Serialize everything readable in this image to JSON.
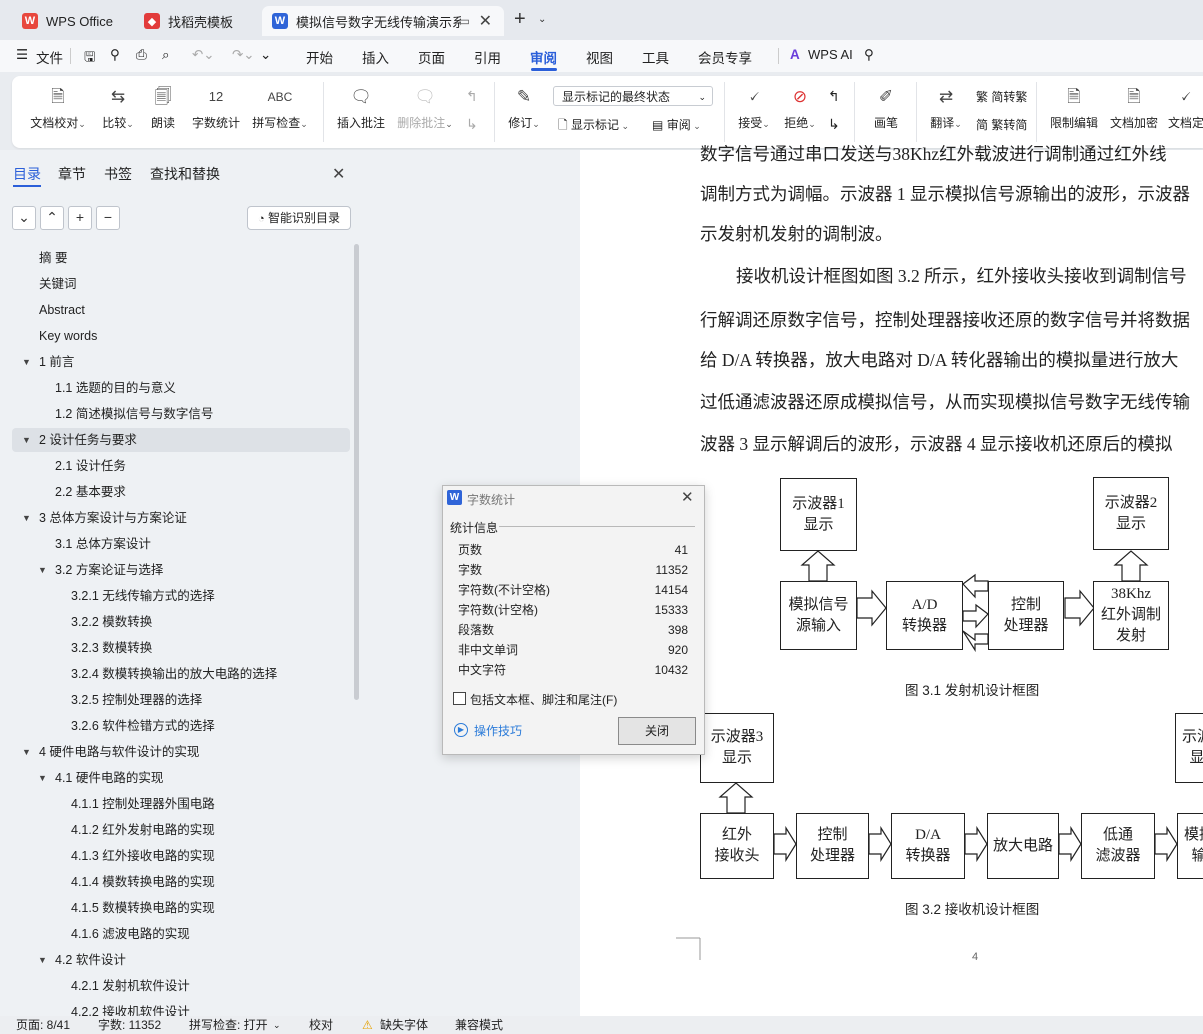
{
  "tabs": [
    {
      "label": "WPS Office"
    },
    {
      "label": "找稻壳模板"
    },
    {
      "label": "模拟信号数字无线传输演示系"
    }
  ],
  "menu": [
    "文件",
    "开始",
    "插入",
    "页面",
    "引用",
    "审阅",
    "视图",
    "工具",
    "会员专享",
    "WPS AI"
  ],
  "ribbon": {
    "doc_check": "文档校对",
    "compare": "比较",
    "read": "朗读",
    "word_count": "字数统计",
    "spell": "拼写检查",
    "insert_comment": "插入批注",
    "delete_comment": "删除批注",
    "revise": "修订",
    "show_mode": "显示标记的最终状态",
    "show_marks": "显示标记",
    "review": "审阅",
    "accept": "接受",
    "reject": "拒绝",
    "pen": "画笔",
    "translate": "翻译",
    "to_trad": "简转繁",
    "to_simp": "繁转简",
    "restrict": "限制编辑",
    "encrypt": "文档加密",
    "doc_final": "文档定"
  },
  "panel": {
    "tabs": [
      "目录",
      "章节",
      "书签",
      "查找和替换"
    ],
    "smart_btn": "智能识别目录",
    "toc": [
      {
        "label": "摘  要",
        "level": 0
      },
      {
        "label": "关键词",
        "level": 0
      },
      {
        "label": "Abstract",
        "level": 0
      },
      {
        "label": "Key words",
        "level": 0
      },
      {
        "label": "1  前言",
        "level": 0,
        "arrow": true
      },
      {
        "label": "1.1  选题的目的与意义",
        "level": 1
      },
      {
        "label": "1.2 简述模拟信号与数字信号",
        "level": 1
      },
      {
        "label": "2  设计任务与要求",
        "level": 0,
        "arrow": true,
        "selected": true
      },
      {
        "label": "2.1  设计任务",
        "level": 1
      },
      {
        "label": "2.2    基本要求",
        "level": 1
      },
      {
        "label": "3  总体方案设计与方案论证",
        "level": 0,
        "arrow": true
      },
      {
        "label": "3.1 总体方案设计",
        "level": 1
      },
      {
        "label": "3.2  方案论证与选择",
        "level": 1,
        "arrow": true
      },
      {
        "label": "3.2.1  无线传输方式的选择",
        "level": 2
      },
      {
        "label": "3.2.2  模数转换",
        "level": 2
      },
      {
        "label": "3.2.3  数模转换",
        "level": 2
      },
      {
        "label": "3.2.4  数模转换输出的放大电路的选择",
        "level": 2
      },
      {
        "label": "3.2.5  控制处理器的选择",
        "level": 2
      },
      {
        "label": "3.2.6  软件检错方式的选择",
        "level": 2
      },
      {
        "label": "4  硬件电路与软件设计的实现",
        "level": 0,
        "arrow": true
      },
      {
        "label": "4.1  硬件电路的实现",
        "level": 1,
        "arrow": true
      },
      {
        "label": "4.1.1  控制处理器外围电路",
        "level": 2
      },
      {
        "label": "4.1.2  红外发射电路的实现",
        "level": 2
      },
      {
        "label": "4.1.3  红外接收电路的实现",
        "level": 2
      },
      {
        "label": "4.1.4  模数转换电路的实现",
        "level": 2
      },
      {
        "label": "4.1.5 数模转换电路的实现",
        "level": 2
      },
      {
        "label": "4.1.6 滤波电路的实现",
        "level": 2
      },
      {
        "label": "4.2  软件设计",
        "level": 1,
        "arrow": true
      },
      {
        "label": "4.2.1  发射机软件设计",
        "level": 2
      },
      {
        "label": "4.2.2  接收机软件设计",
        "level": 2
      }
    ]
  },
  "doc": {
    "lines": [
      "数字信号通过串口发送与38Khz红外载波进行调制通过红外线",
      "调制方式为调幅。示波器 1 显示模拟信号源输出的波形，示波器",
      "示发射机发射的调制波。",
      "接收机设计框图如图 3.2 所示，红外接收头接收到调制信号",
      "行解调还原数字信号，控制处理器接收还原的数字信号并将数据",
      "给 D/A 转换器，放大电路对 D/A 转化器输出的模拟量进行放大",
      "过低通滤波器还原成模拟信号，从而实现模拟信号数字无线传输",
      "波器 3 显示解调后的波形，示波器 4 显示接收机还原后的模拟"
    ],
    "fig1": {
      "osc1": "示波器1\n显示",
      "osc2": "示波器2\n显示",
      "src": "模拟信号\n源输入",
      "ad": "A/D\n转换器",
      "ctrl": "控制\n处理器",
      "ir": "38Khz\n红外调制\n发射",
      "caption": "图 3.1  发射机设计框图"
    },
    "fig2": {
      "osc3": "示波器3\n显示",
      "osc4": "示波\n显",
      "irrx": "红外\n接收头",
      "ctrl": "控制\n处理器",
      "da": "D/A\n转换器",
      "amp": "放大电路",
      "lpf": "低通\n滤波器",
      "out": "模拟\n输",
      "caption": "图 3.2  接收机设计框图"
    },
    "page_num": "4"
  },
  "dialog": {
    "title": "字数统计",
    "section": "统计信息",
    "rows": [
      {
        "k": "页数",
        "v": "41"
      },
      {
        "k": "字数",
        "v": "11352"
      },
      {
        "k": "字符数(不计空格)",
        "v": "14154"
      },
      {
        "k": "字符数(计空格)",
        "v": "15333"
      },
      {
        "k": "段落数",
        "v": "398"
      },
      {
        "k": "非中文单词",
        "v": "920"
      },
      {
        "k": "中文字符",
        "v": "10432"
      }
    ],
    "checkbox": "包括文本框、脚注和尾注(F)",
    "tips": "操作技巧",
    "close": "关闭"
  },
  "status": {
    "page": "页面: 8/41",
    "words": "字数: 11352",
    "spell": "拼写检查: 打开",
    "proof": "校对",
    "font": "缺失字体",
    "compat": "兼容模式"
  },
  "colors": {
    "accent": "#2b5fd9",
    "wps_red": "#e8473d",
    "word_blue": "#2f64d8"
  }
}
